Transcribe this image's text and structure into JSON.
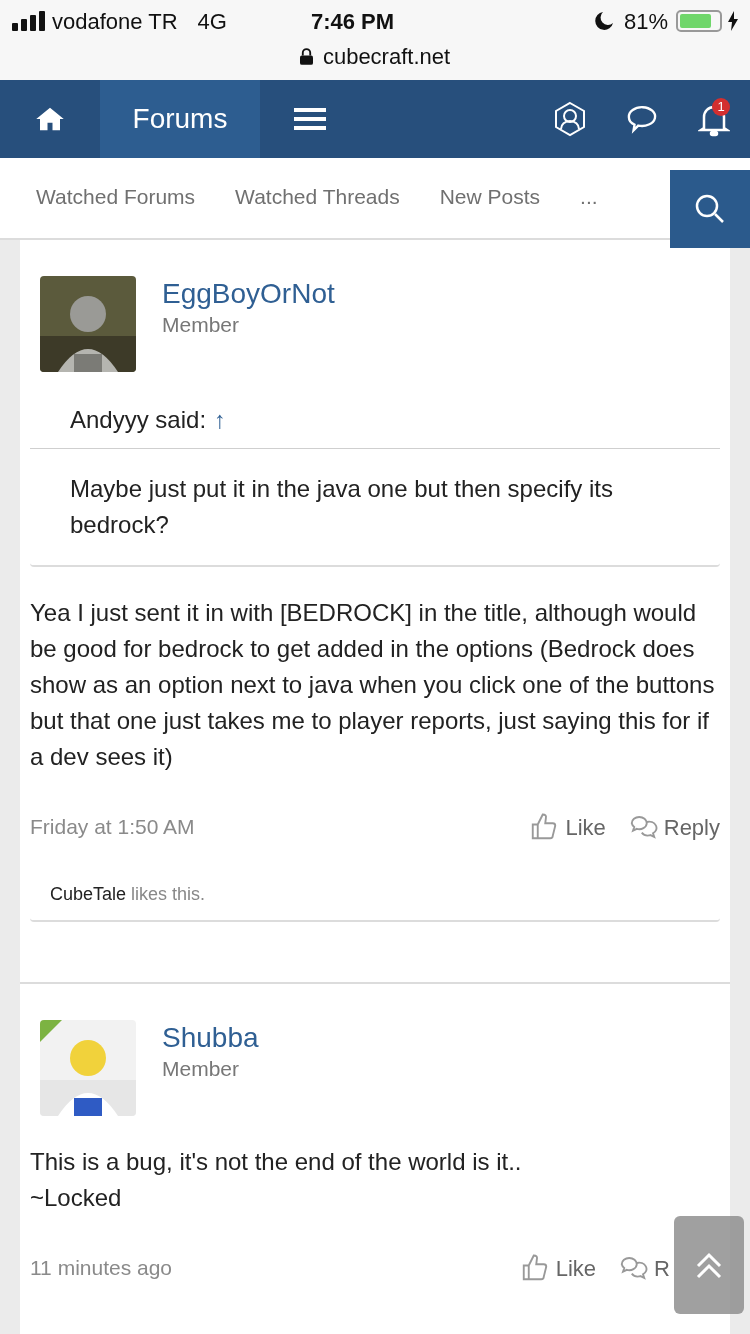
{
  "status_bar": {
    "carrier": "vodafone TR",
    "network": "4G",
    "time": "7:46 PM",
    "battery": "81%",
    "url": "cubecraft.net"
  },
  "nav": {
    "items": [
      {
        "kind": "home",
        "selected": false
      },
      {
        "kind": "text",
        "label": "Forums",
        "selected": true
      },
      {
        "kind": "menu",
        "selected": false
      }
    ],
    "notification_count": "1"
  },
  "subnav": {
    "links": [
      "Watched Forums",
      "Watched Threads",
      "New Posts",
      "..."
    ]
  },
  "posts": [
    {
      "author": "EggBoyOrNot",
      "role": "Member",
      "online": false,
      "quote": {
        "author": "Andyyy said:",
        "arrow": "↑",
        "text": "Maybe just put it in the java one but then specify its bedrock?"
      },
      "body": [
        "Yea I just sent it in with [BEDROCK] in the title, although would be good for bedrock to get added in the options (Bedrock does show as an option next to java when you click one of the buttons but that one just takes me to player reports, just saying this for if a dev sees it)"
      ],
      "time": "Friday at 1:50 AM",
      "like": "Like",
      "reply": "Reply",
      "likes": {
        "user": "CubeTale",
        "text": "likes this."
      }
    },
    {
      "author": "Shubba",
      "role": "Member",
      "online": true,
      "body": [
        "This is a bug, it's not the end of the world is it..",
        "~Locked"
      ],
      "time": "11 minutes ago",
      "like": "Like",
      "reply": "R"
    }
  ]
}
